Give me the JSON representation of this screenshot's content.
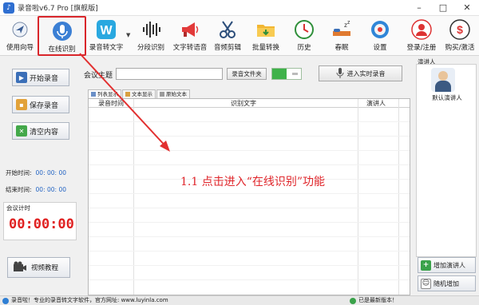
{
  "window": {
    "title": "录音啦v6.7 Pro [旗舰版]",
    "minimize": "–",
    "restore": "□",
    "close": "✕"
  },
  "toolbar": {
    "items": [
      {
        "label": "使用向导",
        "icon": "navigation-icon"
      },
      {
        "label": "在线识别",
        "icon": "microphone-icon"
      },
      {
        "label": "录音转文字",
        "icon": "w-logo-icon"
      },
      {
        "label": "分段识别",
        "icon": "waveform-icon"
      },
      {
        "label": "文字转语音",
        "icon": "megaphone-icon"
      },
      {
        "label": "音频剪辑",
        "icon": "scissors-icon"
      },
      {
        "label": "批量转换",
        "icon": "folder-icon"
      },
      {
        "label": "历史",
        "icon": "history-clock-icon"
      },
      {
        "label": "春眠",
        "icon": "sleep-icon"
      },
      {
        "label": "设置",
        "icon": "gear-icon"
      },
      {
        "label": "登录/注册",
        "icon": "user-icon"
      },
      {
        "label": "购买/激活",
        "icon": "dollar-icon"
      }
    ],
    "active_index": 1,
    "colors": {
      "active_border": "#d9262b"
    }
  },
  "left_panel": {
    "start_record": "开始录音",
    "save_record": "保存录音",
    "clear_content": "清空内容",
    "start_time_label": "开始时间:",
    "start_time_value": "00: 00: 00",
    "end_time_label": "结束时间:",
    "end_time_value": "00: 00: 00",
    "meeting_timer_label": "会议计时",
    "meeting_timer_value": "00:00:00",
    "video_tutorial": "视频教程"
  },
  "main": {
    "topic_label": "会议主题",
    "topic_value": "",
    "record_folder_button": "录音文件夹",
    "realtime_button": "进入实时录音",
    "tabs": [
      "列表显示",
      "文本显示",
      "原始文本"
    ],
    "selected_tab": 0,
    "columns": [
      "录音时间",
      "识别文字",
      "演讲人"
    ],
    "annotation": "1.1  点击进入“在线识别”功能"
  },
  "right_panel": {
    "title": "演讲人",
    "default_speaker": "默认演讲人",
    "add_speaker": "增加演讲人",
    "random_add": "随机增加"
  },
  "status": {
    "left_text": "录音啦！专业的录音转文字软件，官方网址: www.luyinla.com",
    "right_text": "已是最新版本！"
  }
}
